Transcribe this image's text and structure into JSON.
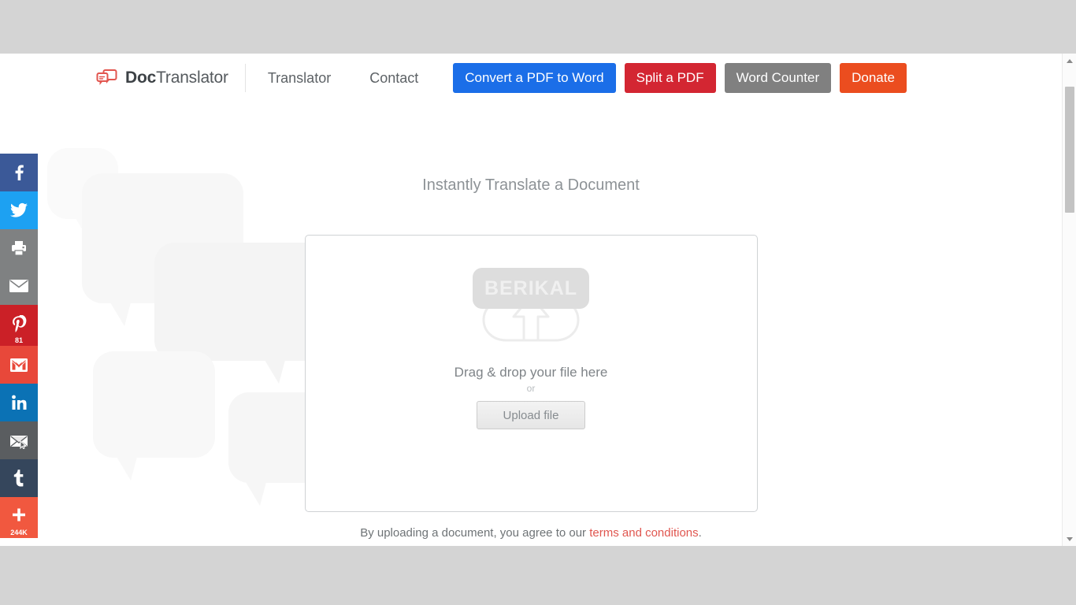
{
  "header": {
    "brand": {
      "bold": "Doc",
      "rest": "Translator",
      "logo_icon": "doc-translator-logo-icon"
    },
    "links": [
      {
        "label": "Translator",
        "name": "nav-link-translator"
      },
      {
        "label": "Contact",
        "name": "nav-link-contact"
      }
    ],
    "buttons": [
      {
        "label": "Convert a PDF to Word",
        "name": "convert-pdf-to-word-button",
        "color": "#1b6ee8",
        "class": "btn-blue"
      },
      {
        "label": "Split a PDF",
        "name": "split-a-pdf-button",
        "color": "#d32632",
        "class": "btn-red"
      },
      {
        "label": "Word Counter",
        "name": "word-counter-button",
        "color": "#808080",
        "class": "btn-gray"
      },
      {
        "label": "Donate",
        "name": "donate-button",
        "color": "#eb4d1f",
        "class": "btn-orange"
      }
    ]
  },
  "main": {
    "title": "Instantly Translate a Document",
    "dropzone": {
      "watermark": "BERIKAL",
      "drag_text": "Drag & drop your file here",
      "or_text": "or",
      "upload_label": "Upload file",
      "cloud_icon": "cloud-upload-icon"
    },
    "terms": {
      "prefix": "By uploading a document, you agree to our ",
      "link": "terms and conditions",
      "suffix": "."
    }
  },
  "social_rail": [
    {
      "name": "share-facebook-button",
      "icon": "facebook-icon",
      "class": "s-fb",
      "count": ""
    },
    {
      "name": "share-twitter-button",
      "icon": "twitter-icon",
      "class": "s-tw",
      "count": ""
    },
    {
      "name": "share-print-button",
      "icon": "print-icon",
      "class": "s-print",
      "count": ""
    },
    {
      "name": "share-email-button",
      "icon": "email-icon",
      "class": "s-mail",
      "count": ""
    },
    {
      "name": "share-pinterest-button",
      "icon": "pinterest-icon",
      "class": "s-pin",
      "count": "81"
    },
    {
      "name": "share-gmail-button",
      "icon": "gmail-icon",
      "class": "s-gmail",
      "count": ""
    },
    {
      "name": "share-linkedin-button",
      "icon": "linkedin-icon",
      "class": "s-in",
      "count": ""
    },
    {
      "name": "share-mailto-button",
      "icon": "envelope-cursor-icon",
      "class": "s-env2",
      "count": ""
    },
    {
      "name": "share-tumblr-button",
      "icon": "tumblr-icon",
      "class": "s-tumblr",
      "count": ""
    },
    {
      "name": "share-more-button",
      "icon": "plus-icon",
      "class": "s-share",
      "count": "244K"
    }
  ],
  "scrollbar": {
    "up_icon": "scroll-up-arrow-icon",
    "down_icon": "scroll-down-arrow-icon",
    "thumb": "scrollbar-thumb"
  }
}
